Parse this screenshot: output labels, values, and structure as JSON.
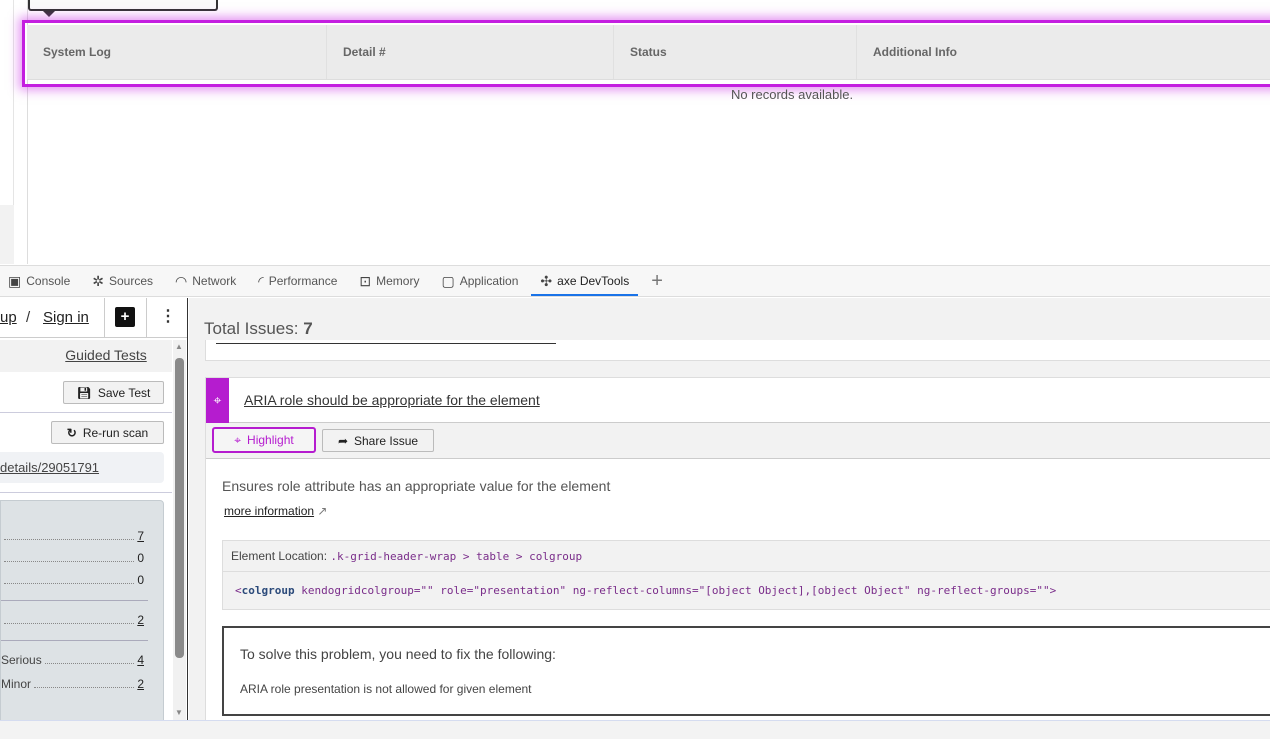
{
  "page": {
    "tooltip": "",
    "grid_headers": [
      "System Log",
      "Detail #",
      "Status",
      "Additional Info"
    ],
    "empty_message": "No records available."
  },
  "devtools_tabs": [
    {
      "label": "Console",
      "icon": "console-icon"
    },
    {
      "label": "Sources",
      "icon": "bug-icon"
    },
    {
      "label": "Network",
      "icon": "wifi-icon"
    },
    {
      "label": "Performance",
      "icon": "gauge-icon"
    },
    {
      "label": "Memory",
      "icon": "chip-icon"
    },
    {
      "label": "Application",
      "icon": "window-icon"
    },
    {
      "label": "axe DevTools",
      "icon": "puzzle-icon",
      "active": true
    }
  ],
  "left": {
    "signup": "up",
    "sep": "/",
    "signin": "Sign in",
    "guided_tests": "Guided Tests",
    "save_test": "Save Test",
    "rerun": "Re-run scan",
    "url": "details/29051791",
    "summary": [
      {
        "label": "",
        "count": "7",
        "link": true
      },
      {
        "label": "",
        "count": "0",
        "link": false
      },
      {
        "label": "",
        "count": "0",
        "link": false
      },
      {
        "label": "",
        "count": "2",
        "link": true
      },
      {
        "label": "Serious",
        "count": "4",
        "link": true
      },
      {
        "label": "Minor",
        "count": "2",
        "link": true
      }
    ]
  },
  "right": {
    "total_label": "Total Issues:",
    "total": "7",
    "issue": {
      "title": "ARIA role should be appropriate for the element",
      "highlight": "Highlight",
      "share": "Share Issue",
      "description": "Ensures role attribute has an appropriate value for the element",
      "more_info": "more information",
      "location_label": "Element Location:",
      "location": ".k-grid-header-wrap > table > colgroup",
      "code_tag": "colgroup",
      "code_rest": " kendogridcolgroup=\"\" role=\"presentation\" ng-reflect-columns=\"[object Object],[object Object\" ng-reflect-groups=\"\">",
      "fix_title": "To solve this problem, you need to fix the following:",
      "fix_item": "ARIA role presentation is not allowed for given element"
    }
  },
  "colors": {
    "accent": "#c41ee0",
    "tab_active": "#1a73e8"
  }
}
